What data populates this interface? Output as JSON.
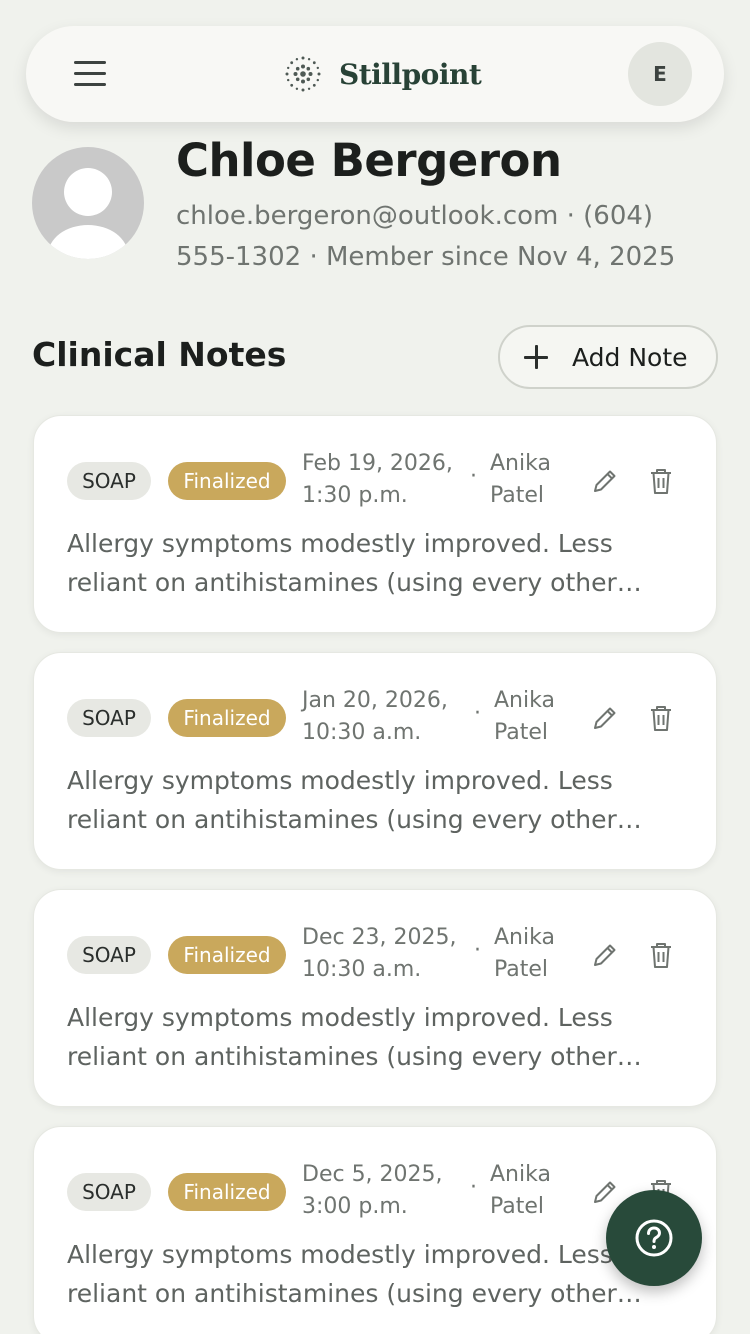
{
  "nav": {
    "brand_name": "Stillpoint",
    "avatar_initial": "E",
    "colors": {
      "brand": "#284236",
      "background": "#f0f2ed"
    }
  },
  "profile": {
    "name": "Chloe Bergeron",
    "meta": "chloe.bergeron@outlook.com · (604) 555-1302 · Member since Nov 4, 2025"
  },
  "notes_section": {
    "title": "Clinical Notes",
    "add_label": "Add Note"
  },
  "notes": [
    {
      "type": "SOAP",
      "status": "Finalized",
      "date": "Feb 19, 2026, 1:30 p.m.",
      "author": "Anika Patel",
      "body": "Allergy symptoms modestly improved. Less reliant on antihistamines (using every other day)."
    },
    {
      "type": "SOAP",
      "status": "Finalized",
      "date": "Jan 20, 2026, 10:30 a.m.",
      "author": "Anika Patel",
      "body": "Allergy symptoms modestly improved. Less reliant on antihistamines (using every other day)."
    },
    {
      "type": "SOAP",
      "status": "Finalized",
      "date": "Dec 23, 2025, 10:30 a.m.",
      "author": "Anika Patel",
      "body": "Allergy symptoms modestly improved. Less reliant on antihistamines (using every other day)."
    },
    {
      "type": "SOAP",
      "status": "Finalized",
      "date": "Dec 5, 2025, 3:00 p.m.",
      "author": "Anika Patel",
      "body": "Allergy symptoms modestly improved. Less reliant on antihistamines (using every other day)."
    }
  ],
  "icons": {
    "menu": "hamburger-menu-icon",
    "logo": "dot-burst-logo-icon",
    "add": "plus-icon",
    "edit": "pencil-icon",
    "delete": "trash-icon",
    "help": "question-mark-icon"
  },
  "status_colors": {
    "finalized": "#c9a85c",
    "soap": "#e7e8e3",
    "fab": "#284a3a"
  }
}
